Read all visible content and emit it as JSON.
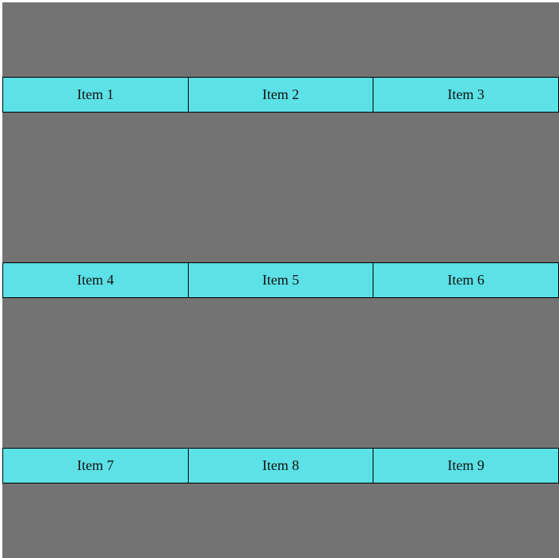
{
  "colors": {
    "background": "#737373",
    "item_fill": "#5ce1e6",
    "border": "#000000"
  },
  "rows": [
    {
      "items": [
        {
          "label": "Item 1"
        },
        {
          "label": "Item 2"
        },
        {
          "label": "Item 3"
        }
      ]
    },
    {
      "items": [
        {
          "label": "Item 4"
        },
        {
          "label": "Item 5"
        },
        {
          "label": "Item 6"
        }
      ]
    },
    {
      "items": [
        {
          "label": "Item 7"
        },
        {
          "label": "Item 8"
        },
        {
          "label": "Item 9"
        }
      ]
    }
  ]
}
